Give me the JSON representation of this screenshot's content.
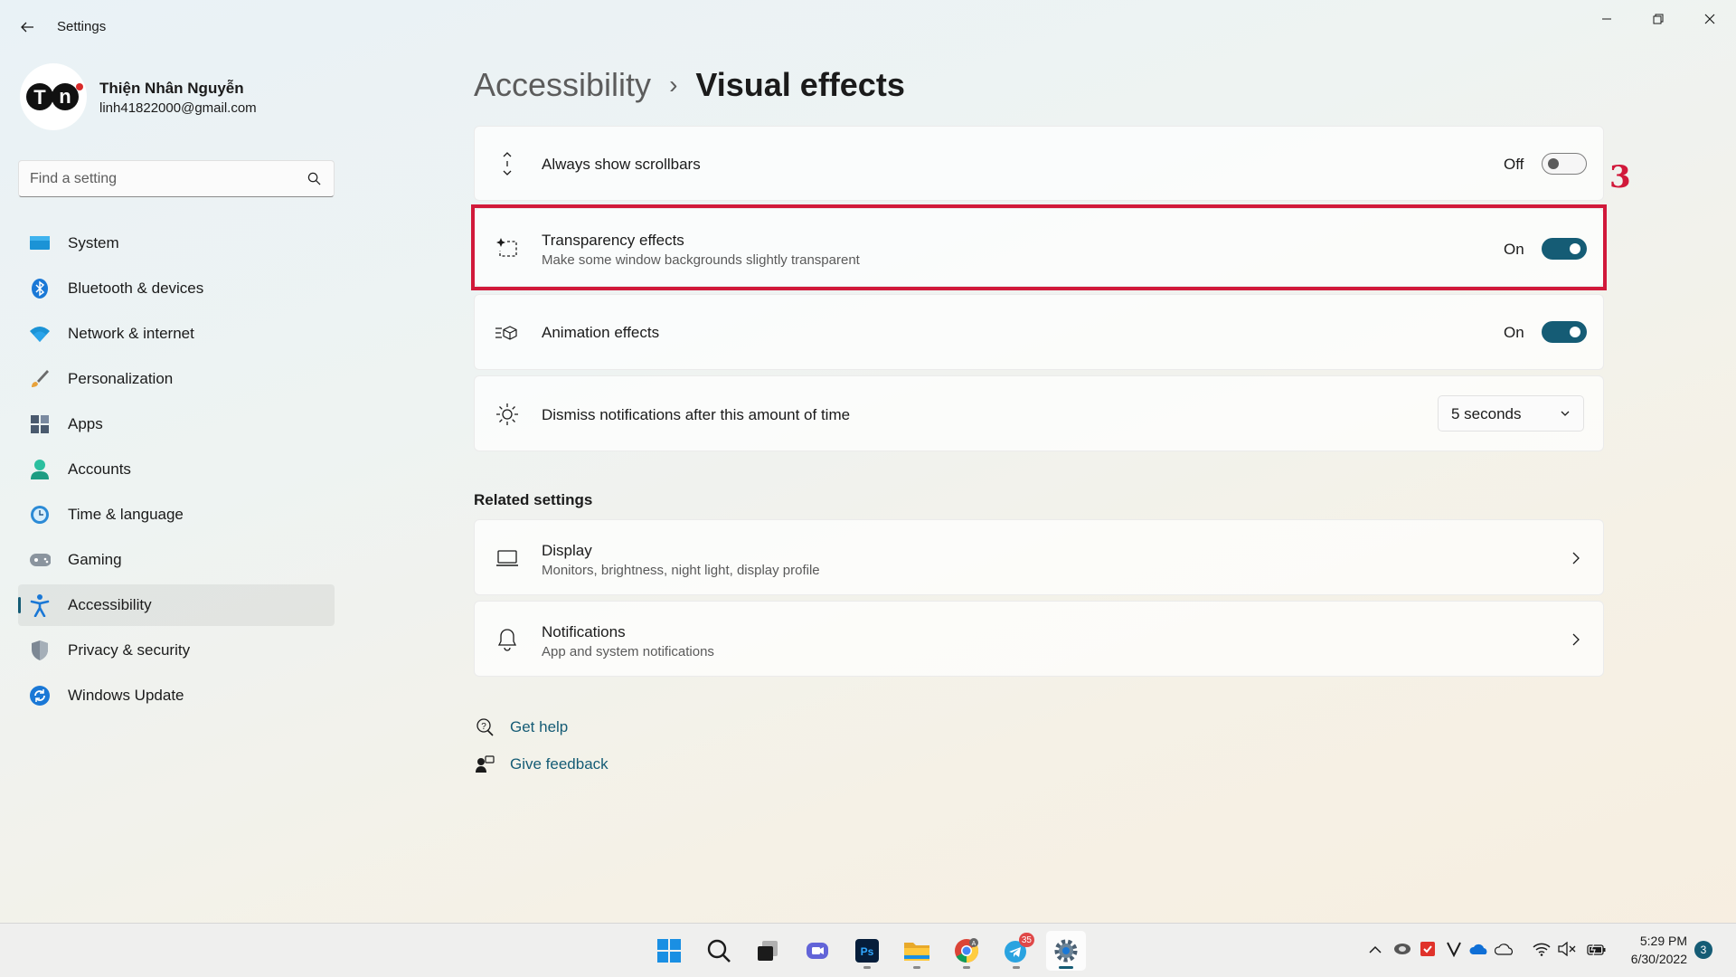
{
  "window": {
    "title": "Settings",
    "controls": {
      "minimize": "minimize",
      "restore": "restore",
      "close": "close"
    }
  },
  "profile": {
    "name": "Thiện Nhân Nguyễn",
    "email": "linh41822000@gmail.com",
    "avatar_text": "TN"
  },
  "search": {
    "placeholder": "Find a setting"
  },
  "sidebar": {
    "items": [
      {
        "label": "System",
        "icon": "monitor-icon"
      },
      {
        "label": "Bluetooth & devices",
        "icon": "bluetooth-icon"
      },
      {
        "label": "Network & internet",
        "icon": "wifi-icon"
      },
      {
        "label": "Personalization",
        "icon": "brush-icon"
      },
      {
        "label": "Apps",
        "icon": "apps-icon"
      },
      {
        "label": "Accounts",
        "icon": "person-icon"
      },
      {
        "label": "Time & language",
        "icon": "globe-clock-icon"
      },
      {
        "label": "Gaming",
        "icon": "gamepad-icon"
      },
      {
        "label": "Accessibility",
        "icon": "accessibility-icon",
        "active": true
      },
      {
        "label": "Privacy & security",
        "icon": "shield-icon"
      },
      {
        "label": "Windows Update",
        "icon": "update-icon"
      }
    ]
  },
  "breadcrumb": {
    "parent": "Accessibility",
    "separator": "›",
    "current": "Visual effects"
  },
  "settings": {
    "scrollbars": {
      "title": "Always show scrollbars",
      "state": "Off"
    },
    "transparency": {
      "title": "Transparency effects",
      "subtitle": "Make some window backgrounds slightly transparent",
      "state": "On"
    },
    "animation": {
      "title": "Animation effects",
      "state": "On"
    },
    "notifications_dismiss": {
      "title": "Dismiss notifications after this amount of time",
      "value": "5 seconds"
    }
  },
  "annotation": {
    "step": "3",
    "color": "#d1193a"
  },
  "related": {
    "title": "Related settings",
    "display": {
      "title": "Display",
      "subtitle": "Monitors, brightness, night light, display profile"
    },
    "notifications": {
      "title": "Notifications",
      "subtitle": "App and system notifications"
    }
  },
  "help": {
    "get_help": "Get help",
    "give_feedback": "Give feedback"
  },
  "taskbar": {
    "apps": [
      "start",
      "search",
      "task-view",
      "chat",
      "photoshop",
      "file-explorer",
      "chrome",
      "telegram",
      "settings"
    ],
    "telegram_badge": "35",
    "clock_time": "5:29 PM",
    "clock_date": "6/30/2022",
    "notification_count": "3"
  },
  "colors": {
    "accent": "#155c75",
    "highlight": "#d1193a"
  }
}
